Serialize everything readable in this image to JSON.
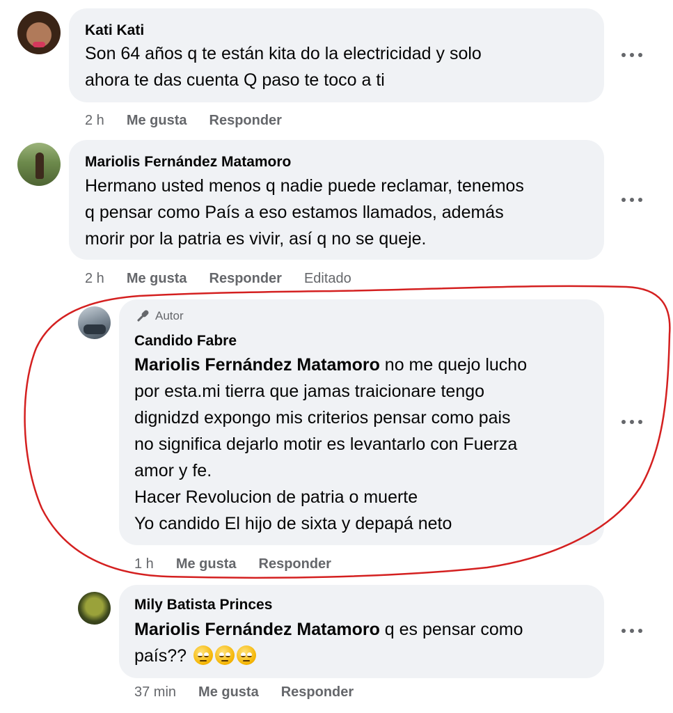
{
  "comments": [
    {
      "author": "Kati Kati",
      "lines": [
        "Son 64 años q te están kita do la electricidad y solo",
        "ahora te das cuenta Q paso te toco a ti"
      ],
      "time": "2 h",
      "like": "Me gusta",
      "reply": "Responder"
    },
    {
      "author": "Mariolis Fernández Matamoro",
      "lines": [
        "Hermano usted menos q nadie puede reclamar, tenemos",
        "q pensar como País a eso estamos llamados, además",
        "morir por la patria es vivir, así q no se queje."
      ],
      "time": "2 h",
      "like": "Me gusta",
      "reply": "Responder",
      "edited": "Editado"
    },
    {
      "badge": "Autor",
      "author": "Candido Fabre",
      "mention": "Mariolis Fernández Matamoro",
      "line1_rest": " no me quejo lucho",
      "lines": [
        "por esta.mi tierra que jamas traicionare tengo",
        "dignidzd expongo mis criterios pensar como pais",
        "no significa dejarlo motir es levantarlo con Fuerza",
        "amor y fe.",
        "Hacer Revolucion de patria o muerte",
        "Yo candido El hijo de sixta y depapá neto"
      ],
      "time": "1 h",
      "like": "Me gusta",
      "reply": "Responder"
    },
    {
      "author": "Mily Batista Princes",
      "mention": "Mariolis Fernández Matamoro",
      "line1_rest": " q es pensar como",
      "line2": "país??",
      "time": "37 min",
      "like": "Me gusta",
      "reply": "Responder"
    }
  ],
  "annotation_color": "#d42020"
}
